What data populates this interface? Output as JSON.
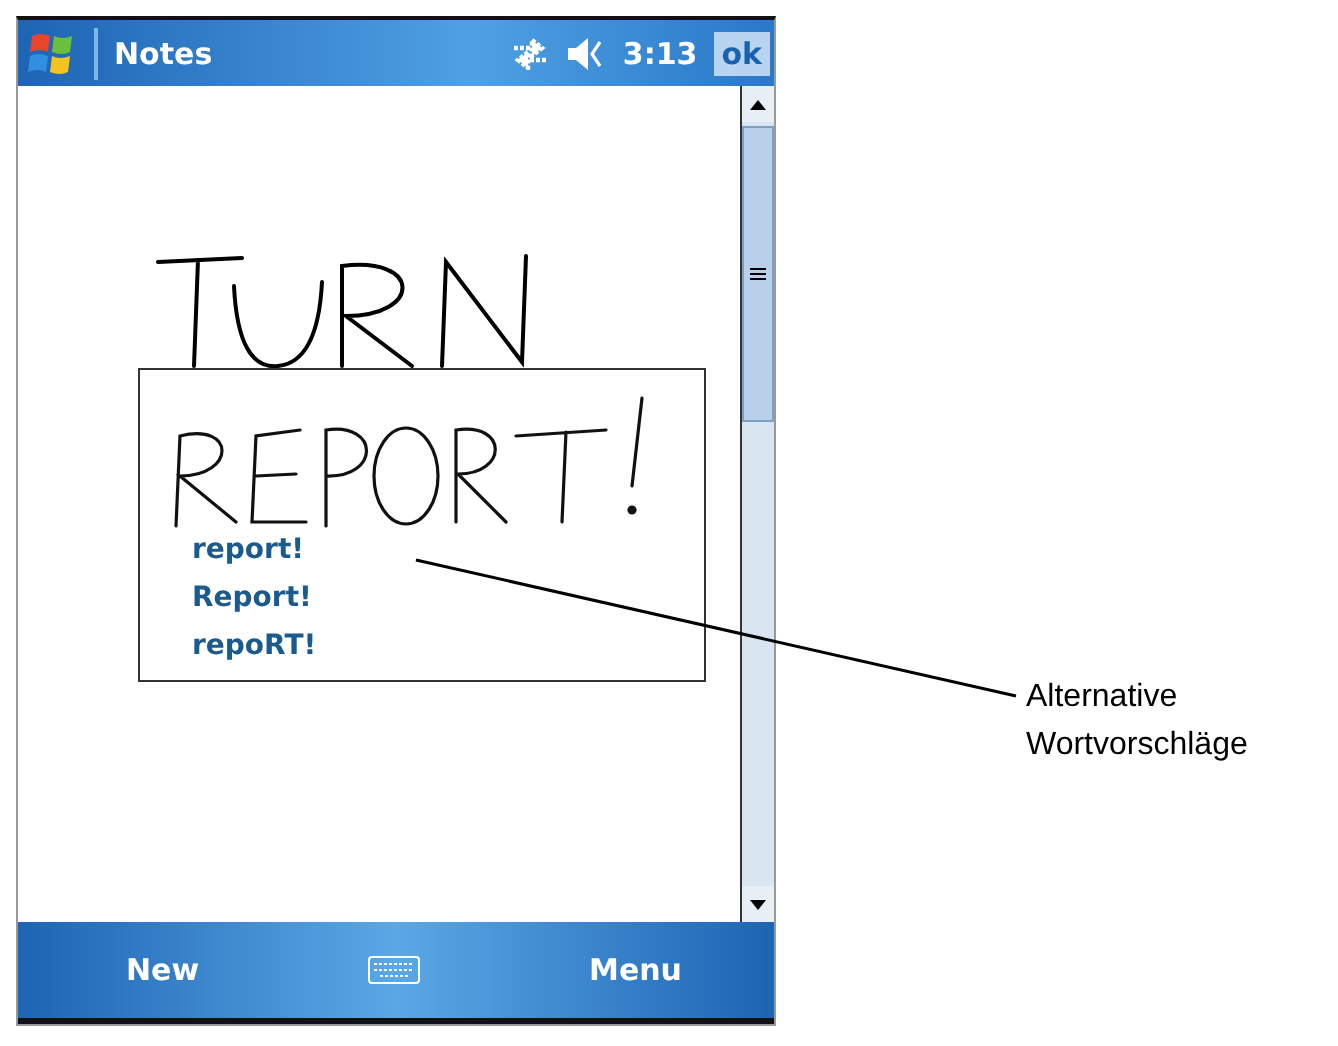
{
  "window": {
    "title": "Notes",
    "time": "3:13",
    "ok_button": "ok"
  },
  "suggestions": [
    "report!",
    "Report!",
    "repoRT!"
  ],
  "softkeys": {
    "left": "New",
    "right": "Menu"
  },
  "callout": {
    "label": "Alternative Wortvorschläge"
  }
}
